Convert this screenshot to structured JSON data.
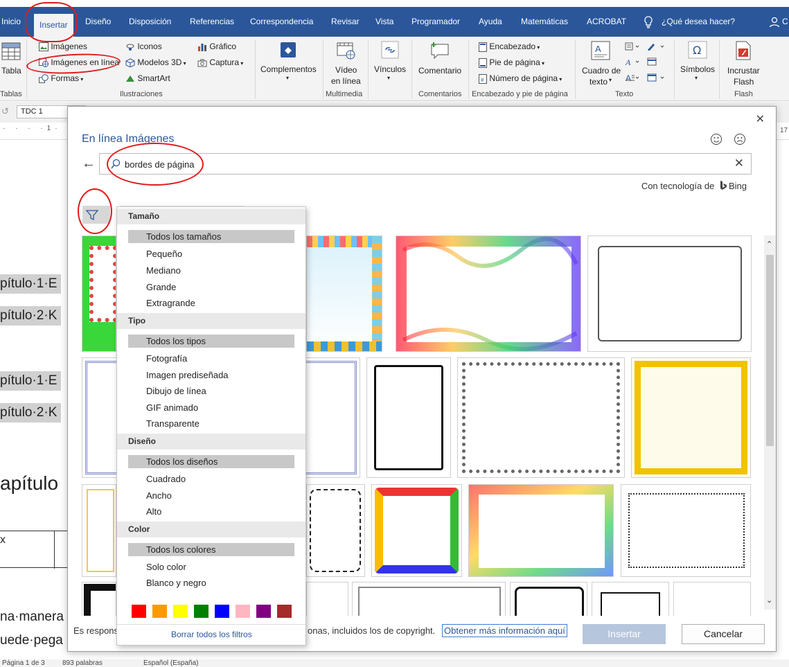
{
  "tabs": [
    {
      "label": "Inicio",
      "active": false
    },
    {
      "label": "Insertar",
      "active": true
    },
    {
      "label": "Diseño",
      "active": false
    },
    {
      "label": "Disposición",
      "active": false
    },
    {
      "label": "Referencias",
      "active": false
    },
    {
      "label": "Correspondencia",
      "active": false
    },
    {
      "label": "Revisar",
      "active": false
    },
    {
      "label": "Vista",
      "active": false
    },
    {
      "label": "Programador",
      "active": false
    },
    {
      "label": "Ayuda",
      "active": false
    },
    {
      "label": "Matemáticas",
      "active": false
    },
    {
      "label": "ACROBAT",
      "active": false
    }
  ],
  "tell_me": "¿Qué desea hacer?",
  "user_initial": "C",
  "ribbon": {
    "tabla": "Tabla",
    "tablas_group": "Tablas",
    "imagenes": "Imágenes",
    "imagenes_linea": "Imágenes en línea",
    "formas": "Formas",
    "iconos": "Iconos",
    "modelos3d": "Modelos 3D",
    "smartart": "SmartArt",
    "grafico": "Gráfico",
    "captura": "Captura",
    "ilustraciones_group": "Ilustraciones",
    "complementos": "Complementos",
    "video_line1": "Vídeo",
    "video_line2": "en línea",
    "multimedia_group": "Multimedia",
    "vinculos": "Vínculos",
    "comentario": "Comentario",
    "comentarios_group": "Comentarios",
    "encabezado": "Encabezado",
    "pie": "Pie de página",
    "numero": "Número de página",
    "encabezado_group": "Encabezado y pie de página",
    "cuadro_line1": "Cuadro de",
    "cuadro_line2": "texto",
    "texto_group": "Texto",
    "simbolos": "Símbolos",
    "incrustar_line1": "Incrustar",
    "incrustar_line2": "Flash",
    "flash_group": "Flash"
  },
  "doc": {
    "style_box": "TDC 1",
    "ruler_right": "17",
    "lines": [
      "pítulo·1·E",
      "pítulo·2·K",
      "pítulo·1·E",
      "pítulo·2·K"
    ],
    "heading": "apítulo",
    "cell": "x",
    "body1": "na·manera",
    "body2": "uede·pega"
  },
  "status": {
    "page": "Página 1 de 3",
    "words": "893 palabras",
    "lang": "Español (España)"
  },
  "dialog": {
    "title": "En línea Imágenes",
    "search_value": "bordes de página",
    "powered_by": "Con tecnología de",
    "bing": "Bing",
    "footer_text_left": "Es respons",
    "footer_text_right": "onas, incluidos los de copyright.",
    "footer_link": "Obtener más información aquí",
    "insert_button": "Insertar",
    "cancel_button": "Cancelar"
  },
  "filter_menu": {
    "size_header": "Tamaño",
    "size_selected": "Todos los tamaños",
    "size_options": [
      "Pequeño",
      "Mediano",
      "Grande",
      "Extragrande"
    ],
    "type_header": "Tipo",
    "type_selected": "Todos los tipos",
    "type_options": [
      "Fotografía",
      "Imagen prediseñada",
      "Dibujo de línea",
      "GIF animado",
      "Transparente"
    ],
    "layout_header": "Diseño",
    "layout_selected": "Todos los diseños",
    "layout_options": [
      "Cuadrado",
      "Ancho",
      "Alto"
    ],
    "color_header": "Color",
    "color_selected": "Todos los colores",
    "color_options": [
      "Solo color",
      "Blanco y negro"
    ],
    "swatches": [
      "#ff0000",
      "#ff9900",
      "#ffff00",
      "#008000",
      "#0000ff",
      "#ffb6c1",
      "#800080",
      "#a52a2a"
    ],
    "clear": "Borrar todos los filtros"
  }
}
